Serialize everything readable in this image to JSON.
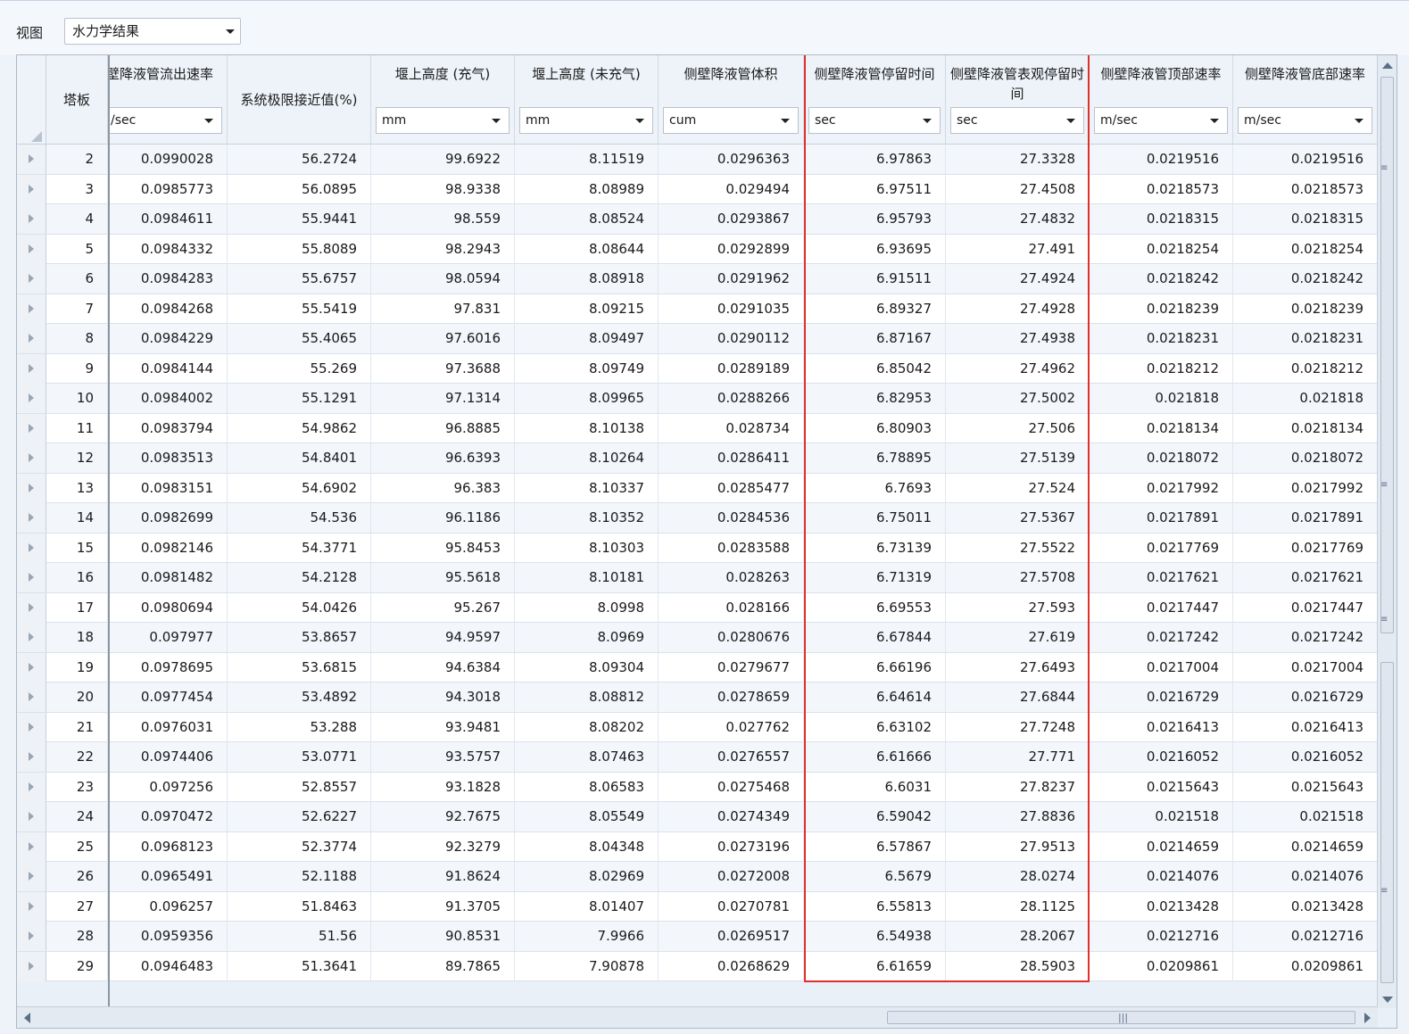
{
  "toolbar": {
    "view_label": "视图",
    "view_selected": "水力学结果"
  },
  "columns": [
    {
      "key": "tray",
      "title": "塔板",
      "unit": null
    },
    {
      "key": "dc_exit_vel",
      "title": "壁降液管流出速率",
      "unit": "/sec"
    },
    {
      "key": "sys_limit",
      "title": "系统极限接近值(%)",
      "unit": null
    },
    {
      "key": "weir_aer",
      "title": "堰上高度 (充气)",
      "unit": "mm"
    },
    {
      "key": "weir_unaer",
      "title": "堰上高度 (未充气)",
      "unit": "mm"
    },
    {
      "key": "dc_volume",
      "title": "侧壁降液管体积",
      "unit": "cum"
    },
    {
      "key": "dc_res_time",
      "title": "侧壁降液管停留时间",
      "unit": "sec"
    },
    {
      "key": "dc_app_res_time",
      "title": "侧壁降液管表观停留时间",
      "unit": "sec"
    },
    {
      "key": "dc_top_vel",
      "title": "侧壁降液管顶部速率",
      "unit": "m/sec"
    },
    {
      "key": "dc_bot_vel",
      "title": "侧壁降液管底部速率",
      "unit": "m/sec"
    }
  ],
  "rows": [
    [
      "2",
      "0.0990028",
      "56.2724",
      "99.6922",
      "8.11519",
      "0.0296363",
      "6.97863",
      "27.3328",
      "0.0219516",
      "0.0219516"
    ],
    [
      "3",
      "0.0985773",
      "56.0895",
      "98.9338",
      "8.08989",
      "0.029494",
      "6.97511",
      "27.4508",
      "0.0218573",
      "0.0218573"
    ],
    [
      "4",
      "0.0984611",
      "55.9441",
      "98.559",
      "8.08524",
      "0.0293867",
      "6.95793",
      "27.4832",
      "0.0218315",
      "0.0218315"
    ],
    [
      "5",
      "0.0984332",
      "55.8089",
      "98.2943",
      "8.08644",
      "0.0292899",
      "6.93695",
      "27.491",
      "0.0218254",
      "0.0218254"
    ],
    [
      "6",
      "0.0984283",
      "55.6757",
      "98.0594",
      "8.08918",
      "0.0291962",
      "6.91511",
      "27.4924",
      "0.0218242",
      "0.0218242"
    ],
    [
      "7",
      "0.0984268",
      "55.5419",
      "97.831",
      "8.09215",
      "0.0291035",
      "6.89327",
      "27.4928",
      "0.0218239",
      "0.0218239"
    ],
    [
      "8",
      "0.0984229",
      "55.4065",
      "97.6016",
      "8.09497",
      "0.0290112",
      "6.87167",
      "27.4938",
      "0.0218231",
      "0.0218231"
    ],
    [
      "9",
      "0.0984144",
      "55.269",
      "97.3688",
      "8.09749",
      "0.0289189",
      "6.85042",
      "27.4962",
      "0.0218212",
      "0.0218212"
    ],
    [
      "10",
      "0.0984002",
      "55.1291",
      "97.1314",
      "8.09965",
      "0.0288266",
      "6.82953",
      "27.5002",
      "0.021818",
      "0.021818"
    ],
    [
      "11",
      "0.0983794",
      "54.9862",
      "96.8885",
      "8.10138",
      "0.028734",
      "6.80903",
      "27.506",
      "0.0218134",
      "0.0218134"
    ],
    [
      "12",
      "0.0983513",
      "54.8401",
      "96.6393",
      "8.10264",
      "0.0286411",
      "6.78895",
      "27.5139",
      "0.0218072",
      "0.0218072"
    ],
    [
      "13",
      "0.0983151",
      "54.6902",
      "96.383",
      "8.10337",
      "0.0285477",
      "6.7693",
      "27.524",
      "0.0217992",
      "0.0217992"
    ],
    [
      "14",
      "0.0982699",
      "54.536",
      "96.1186",
      "8.10352",
      "0.0284536",
      "6.75011",
      "27.5367",
      "0.0217891",
      "0.0217891"
    ],
    [
      "15",
      "0.0982146",
      "54.3771",
      "95.8453",
      "8.10303",
      "0.0283588",
      "6.73139",
      "27.5522",
      "0.0217769",
      "0.0217769"
    ],
    [
      "16",
      "0.0981482",
      "54.2128",
      "95.5618",
      "8.10181",
      "0.028263",
      "6.71319",
      "27.5708",
      "0.0217621",
      "0.0217621"
    ],
    [
      "17",
      "0.0980694",
      "54.0426",
      "95.267",
      "8.0998",
      "0.028166",
      "6.69553",
      "27.593",
      "0.0217447",
      "0.0217447"
    ],
    [
      "18",
      "0.097977",
      "53.8657",
      "94.9597",
      "8.0969",
      "0.0280676",
      "6.67844",
      "27.619",
      "0.0217242",
      "0.0217242"
    ],
    [
      "19",
      "0.0978695",
      "53.6815",
      "94.6384",
      "8.09304",
      "0.0279677",
      "6.66196",
      "27.6493",
      "0.0217004",
      "0.0217004"
    ],
    [
      "20",
      "0.0977454",
      "53.4892",
      "94.3018",
      "8.08812",
      "0.0278659",
      "6.64614",
      "27.6844",
      "0.0216729",
      "0.0216729"
    ],
    [
      "21",
      "0.0976031",
      "53.288",
      "93.9481",
      "8.08202",
      "0.027762",
      "6.63102",
      "27.7248",
      "0.0216413",
      "0.0216413"
    ],
    [
      "22",
      "0.0974406",
      "53.0771",
      "93.5757",
      "8.07463",
      "0.0276557",
      "6.61666",
      "27.771",
      "0.0216052",
      "0.0216052"
    ],
    [
      "23",
      "0.097256",
      "52.8557",
      "93.1828",
      "8.06583",
      "0.0275468",
      "6.6031",
      "27.8237",
      "0.0215643",
      "0.0215643"
    ],
    [
      "24",
      "0.0970472",
      "52.6227",
      "92.7675",
      "8.05549",
      "0.0274349",
      "6.59042",
      "27.8836",
      "0.021518",
      "0.021518"
    ],
    [
      "25",
      "0.0968123",
      "52.3774",
      "92.3279",
      "8.04348",
      "0.0273196",
      "6.57867",
      "27.9513",
      "0.0214659",
      "0.0214659"
    ],
    [
      "26",
      "0.0965491",
      "52.1188",
      "91.8624",
      "8.02969",
      "0.0272008",
      "6.5679",
      "28.0274",
      "0.0214076",
      "0.0214076"
    ],
    [
      "27",
      "0.096257",
      "51.8463",
      "91.3705",
      "8.01407",
      "0.0270781",
      "6.55813",
      "28.1125",
      "0.0213428",
      "0.0213428"
    ],
    [
      "28",
      "0.0959356",
      "51.56",
      "90.8531",
      "7.9966",
      "0.0269517",
      "6.54938",
      "28.2067",
      "0.0212716",
      "0.0212716"
    ],
    [
      "29",
      "0.0946483",
      "51.3641",
      "89.7865",
      "7.90878",
      "0.0268629",
      "6.61659",
      "28.5903",
      "0.0209861",
      "0.0209861"
    ]
  ],
  "colors": {
    "highlight": "#e0302c",
    "row_alt": "#f3f7fc",
    "header_bg": "#eef3f9"
  }
}
